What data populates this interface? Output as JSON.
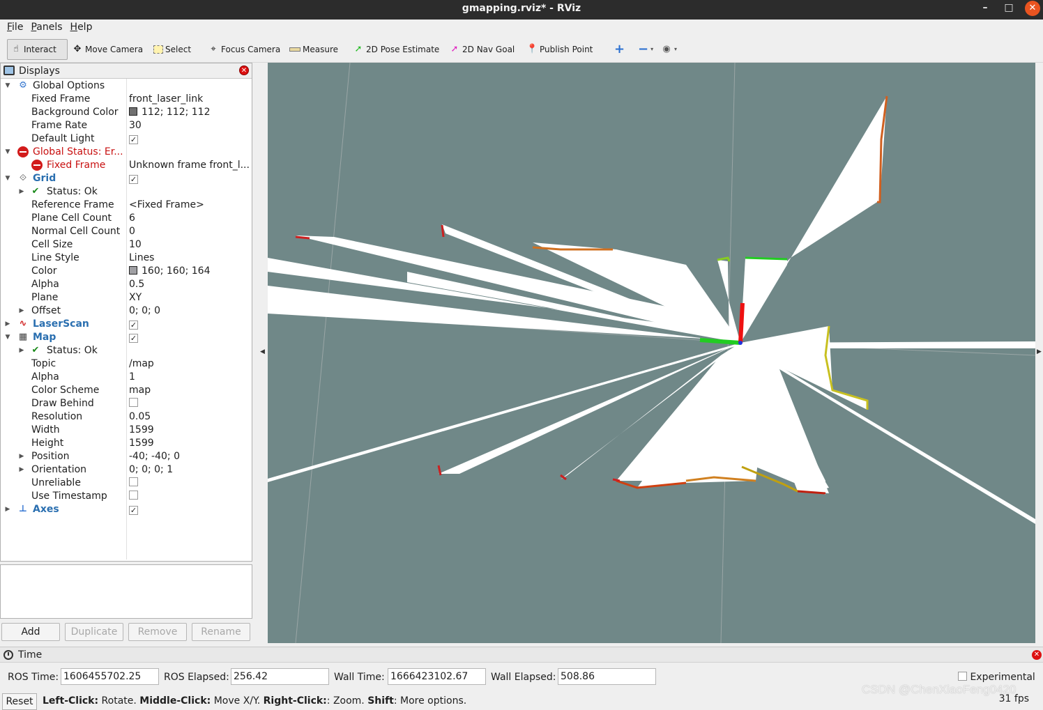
{
  "window": {
    "title": "gmapping.rviz* - RViz",
    "minimize": "–",
    "maximize": "□",
    "close": "✕"
  },
  "menu": {
    "file": "File",
    "panels": "Panels",
    "help": "Help"
  },
  "toolbar": {
    "interact": "Interact",
    "move_camera": "Move Camera",
    "select": "Select",
    "focus_camera": "Focus Camera",
    "measure": "Measure",
    "pose_estimate": "2D Pose Estimate",
    "nav_goal": "2D Nav Goal",
    "publish_point": "Publish Point",
    "add_icon": "+",
    "remove_icon": "−",
    "eye_icon": "eye-icon"
  },
  "displays": {
    "title": "Displays",
    "global_options": {
      "label": "Global Options",
      "fixed_frame_label": "Fixed Frame",
      "fixed_frame": "front_laser_link",
      "background_color_label": "Background Color",
      "background_color": "112; 112; 112",
      "background_swatch": "#707070",
      "frame_rate_label": "Frame Rate",
      "frame_rate": "30",
      "default_light_label": "Default Light",
      "default_light": true
    },
    "global_status": {
      "label": "Global Status: Er...",
      "fixed_frame_label": "Fixed Frame",
      "fixed_frame_msg": "Unknown frame front_l..."
    },
    "grid": {
      "label": "Grid",
      "enabled": true,
      "status": "Status: Ok",
      "reference_frame_label": "Reference Frame",
      "reference_frame": "<Fixed Frame>",
      "plane_cell_count_label": "Plane Cell Count",
      "plane_cell_count": "6",
      "normal_cell_count_label": "Normal Cell Count",
      "normal_cell_count": "0",
      "cell_size_label": "Cell Size",
      "cell_size": "10",
      "line_style_label": "Line Style",
      "line_style": "Lines",
      "color_label": "Color",
      "color": "160; 160; 164",
      "color_swatch": "#a0a0a4",
      "alpha_label": "Alpha",
      "alpha": "0.5",
      "plane_label": "Plane",
      "plane": "XY",
      "offset_label": "Offset",
      "offset": "0; 0; 0"
    },
    "laserscan": {
      "label": "LaserScan",
      "enabled": true
    },
    "map": {
      "label": "Map",
      "enabled": true,
      "status": "Status: Ok",
      "topic_label": "Topic",
      "topic": "/map",
      "alpha_label": "Alpha",
      "alpha": "1",
      "color_scheme_label": "Color Scheme",
      "color_scheme": "map",
      "draw_behind_label": "Draw Behind",
      "draw_behind": false,
      "resolution_label": "Resolution",
      "resolution": "0.05",
      "width_label": "Width",
      "width": "1599",
      "height_label": "Height",
      "height": "1599",
      "position_label": "Position",
      "position": "-40; -40; 0",
      "orientation_label": "Orientation",
      "orientation": "0; 0; 0; 1",
      "unreliable_label": "Unreliable",
      "unreliable": false,
      "use_timestamp_label": "Use Timestamp",
      "use_timestamp": false
    },
    "axes": {
      "label": "Axes",
      "enabled": true
    },
    "buttons": {
      "add": "Add",
      "duplicate": "Duplicate",
      "remove": "Remove",
      "rename": "Rename"
    }
  },
  "time": {
    "title": "Time",
    "ros_time_label": "ROS Time:",
    "ros_time": "1606455702.25",
    "ros_elapsed_label": "ROS Elapsed:",
    "ros_elapsed": "256.42",
    "wall_time_label": "Wall Time:",
    "wall_time": "1666423102.67",
    "wall_elapsed_label": "Wall Elapsed:",
    "wall_elapsed": "508.86",
    "experimental_label": "Experimental",
    "experimental": false
  },
  "status": {
    "reset": "Reset",
    "hint_left_bold": "Left-Click:",
    "hint_left": " Rotate. ",
    "hint_middle_bold": "Middle-Click:",
    "hint_middle": " Move X/Y. ",
    "hint_right_bold": "Right-Click:",
    "hint_right": ": Zoom. ",
    "hint_shift_bold": "Shift",
    "hint_shift": ": More options.",
    "fps": "31 fps"
  },
  "viewport": {
    "background": "#708888",
    "free_space": "#ffffff"
  },
  "watermark": "CSDN @ChenXiaoFeng0420"
}
